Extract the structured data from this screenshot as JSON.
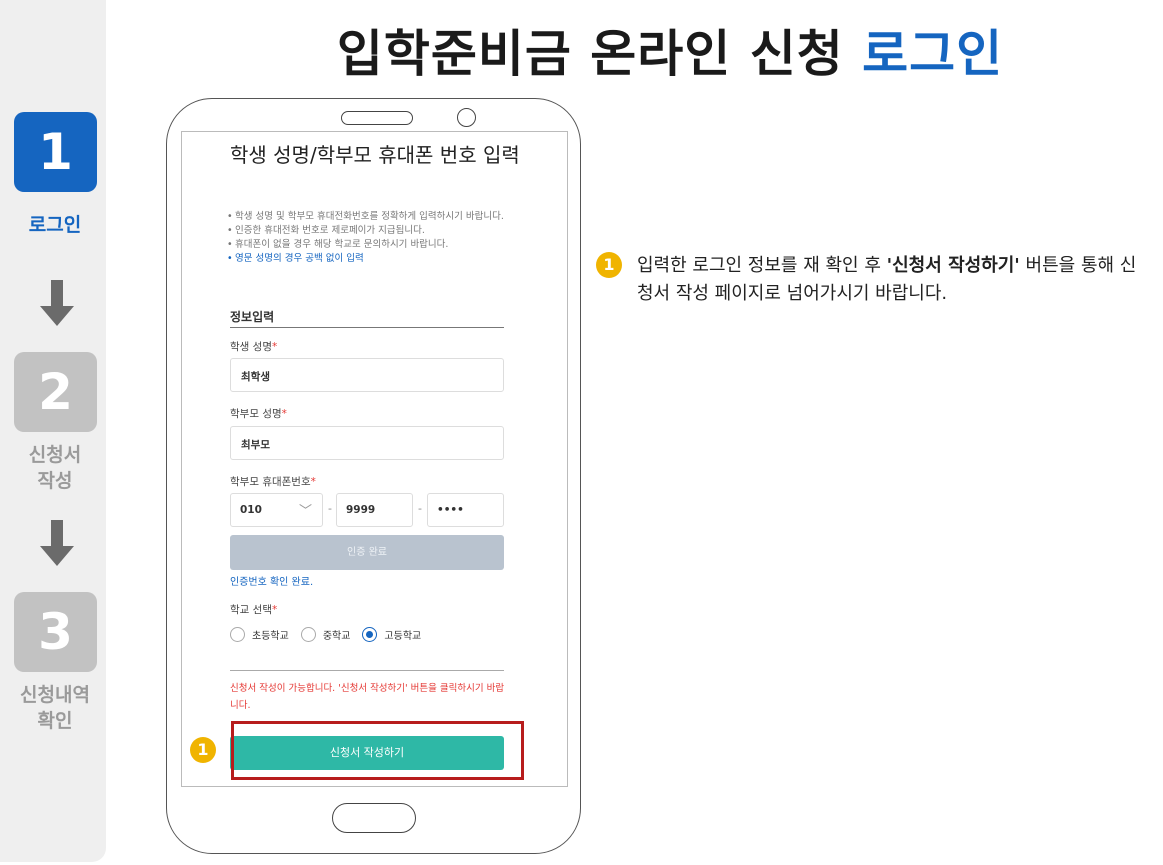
{
  "page": {
    "title_main": "입학준비금 온라인 신청",
    "title_accent": "로그인"
  },
  "sidebar": {
    "steps": [
      {
        "number": "1",
        "label": "로그인",
        "active": true
      },
      {
        "number": "2",
        "label": "신청서 작성",
        "active": false
      },
      {
        "number": "3",
        "label": "신청내역 확인",
        "active": false
      }
    ]
  },
  "form": {
    "title": "학생 성명/학부모 휴대폰 번호 입력",
    "notes": [
      "학생 성명 및 학부모 휴대전화번호를 정확하게 입력하시기 바랍니다.",
      "인증한 휴대전화 번호로 제로페이가 지급됩니다.",
      "휴대폰이 없을 경우 해당 학교로 문의하시기 바랍니다.",
      "영문 성명의 경우 공백 없이 입력"
    ],
    "section_title": "정보입력",
    "required_mark": "*",
    "student_name_label": "학생 성명",
    "student_name_value": "최학생",
    "parent_name_label": "학부모 성명",
    "parent_name_value": "최부모",
    "phone_label": "학부모 휴대폰번호",
    "phone_prefix": "010",
    "phone_middle": "9999",
    "phone_last": "••••",
    "phone_separator": "-",
    "verify_button": "인증 완료",
    "verify_message": "인증번호 확인 완료.",
    "school_label": "학교 선택",
    "school_options": [
      {
        "label": "초등학교",
        "checked": false
      },
      {
        "label": "중학교",
        "checked": false
      },
      {
        "label": "고등학교",
        "checked": true
      }
    ],
    "warning": "신청서 작성이 가능합니다. '신청서 작성하기' 버튼을 클릭하시기 바랍니다.",
    "submit_button": "신청서 작성하기"
  },
  "guide": {
    "marker": "1",
    "text_before": "입력한 로그인 정보를 재 확인 후 ",
    "text_bold": "'신청서 작성하기'",
    "text_after": " 버튼을 통해 신청서 작성 페이지로 넘어가시기 바랍니다."
  },
  "colors": {
    "accent": "#1565c0",
    "submit": "#2eb8a6",
    "marker": "#f0b400",
    "highlight": "#b71c1c",
    "warning": "#e53935"
  }
}
